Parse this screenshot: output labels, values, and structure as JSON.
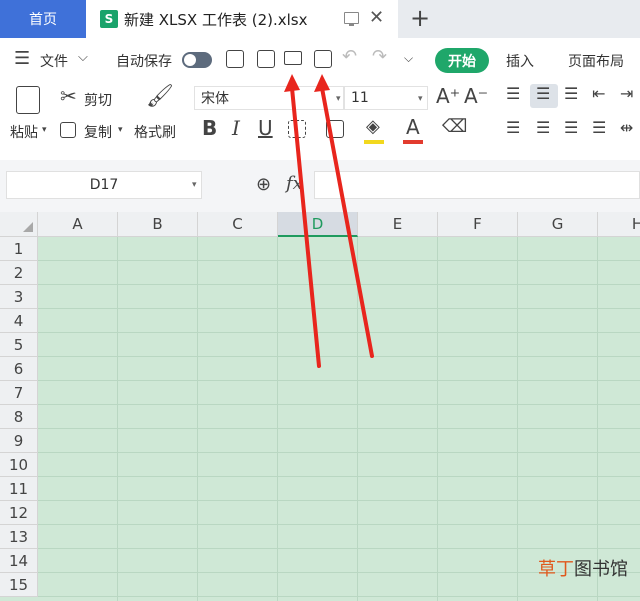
{
  "tabs": {
    "home_label": "首页",
    "file_tab_icon": "S",
    "file_tab_title": "新建 XLSX 工作表 (2).xlsx",
    "new_tab_glyph": "+"
  },
  "toolbar": {
    "menu_label": "文件",
    "autosave_label": "自动保存",
    "start_label": "开始",
    "insert_label": "插入",
    "page_layout_label": "页面布局"
  },
  "ribbon": {
    "paste_label": "粘贴",
    "cut_label": "剪切",
    "copy_label": "复制",
    "format_painter_label": "格式刷",
    "font_name": "宋体",
    "font_size": "11",
    "bold": "B",
    "italic": "I",
    "underline": "U",
    "font_color_glyph": "A",
    "font_color_accent": "#e23b2e",
    "fill_color_accent": "#f2d81e"
  },
  "formula_bar": {
    "name_box_value": "D17",
    "fx_label": "fx"
  },
  "grid": {
    "columns": [
      "A",
      "B",
      "C",
      "D",
      "E",
      "F",
      "G",
      "H"
    ],
    "active_column": "D",
    "rows": [
      "1",
      "2",
      "3",
      "4",
      "5",
      "6",
      "7",
      "8",
      "9",
      "10",
      "11",
      "12",
      "13",
      "14",
      "15"
    ],
    "cell_background": "#cfe8d6"
  },
  "annotation": {
    "arrow_color": "#e8251d"
  },
  "watermark": {
    "highlight_text": "草丁",
    "rest_text": "图书馆"
  }
}
